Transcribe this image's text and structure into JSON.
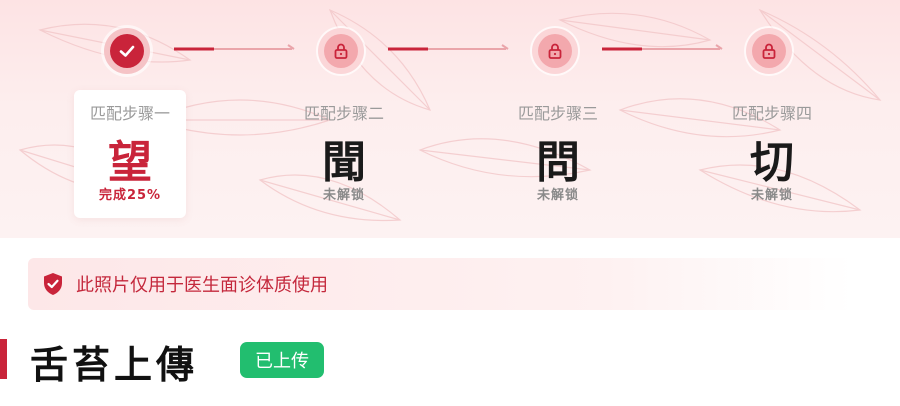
{
  "steps": [
    {
      "label": "匹配步骤一",
      "char": "望",
      "status": "完成25%",
      "state": "done",
      "icon": "check-icon"
    },
    {
      "label": "匹配步骤二",
      "char": "聞",
      "status": "未解锁",
      "state": "locked",
      "icon": "lock-icon"
    },
    {
      "label": "匹配步骤三",
      "char": "問",
      "status": "未解锁",
      "state": "locked",
      "icon": "lock-icon"
    },
    {
      "label": "匹配步骤四",
      "char": "切",
      "status": "未解锁",
      "state": "locked",
      "icon": "lock-icon"
    }
  ],
  "progress": {
    "completed_fraction": 0.25
  },
  "notice": {
    "text": "此照片仅用于医生面诊体质使用",
    "icon": "shield-check-icon"
  },
  "section": {
    "title": "舌苔上傳",
    "tag": "已上传"
  },
  "colors": {
    "accent": "#c9243a",
    "success": "#22be6f",
    "banner": "#fde3e4",
    "muted": "#9a9a9a"
  }
}
